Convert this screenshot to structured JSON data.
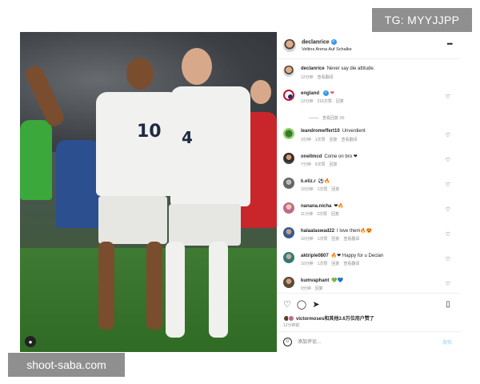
{
  "watermarks": {
    "top_right": "TG: MYYJJPP",
    "bottom_left": "shoot-saba.com"
  },
  "header": {
    "username": "declanrice",
    "location": "Veltins Arena Auf Schalke",
    "more_icon": "more-horizontal-icon"
  },
  "photo": {
    "player_left_number": "10",
    "player_right_number": "4",
    "user_tag_icon": "user-tag-icon"
  },
  "comments": [
    {
      "username": "declanrice",
      "text": "Never say die attitude.",
      "time": "12分钟",
      "likes": "",
      "reply": "",
      "translate": "查看翻译",
      "avatar": "av-declan"
    },
    {
      "username": "england",
      "text": "❤",
      "time": "12分钟",
      "likes": "216次赞",
      "reply": "回复",
      "translate": "",
      "avatar": "av-england"
    },
    {
      "username": "leandromeffert10",
      "text": "Unverdient",
      "time": "3分钟",
      "likes": "1次赞",
      "reply": "回复",
      "translate": "查看翻译",
      "avatar": "av-green"
    },
    {
      "username": "onellmcd",
      "text": "Come on bro ❤",
      "time": "7分钟",
      "likes": "6次赞",
      "reply": "回复",
      "translate": "",
      "avatar": "av-dark"
    },
    {
      "username": "k.eliz.r",
      "text": "⚽🔥",
      "time": "10分钟",
      "likes": "1次赞",
      "reply": "回复",
      "translate": "",
      "avatar": "av-grey"
    },
    {
      "username": "nanana.nicha",
      "text": "❤🔥",
      "time": "11分钟",
      "likes": "2次赞",
      "reply": "回复",
      "translate": "",
      "avatar": "av-pink"
    },
    {
      "username": "halaalaswad22",
      "text": "I love them🔥😍",
      "time": "10分钟",
      "likes": "1次赞",
      "reply": "回复",
      "translate": "查看翻译",
      "avatar": "av-blue"
    },
    {
      "username": "aktriple0807",
      "text": "🔥❤ Happy for u Declan",
      "time": "10分钟",
      "likes": "1次赞",
      "reply": "回复",
      "translate": "查看翻译",
      "avatar": "av-teal"
    },
    {
      "username": "kumvaphant",
      "text": "💚💙",
      "time": "9分钟",
      "likes": "",
      "reply": "回复",
      "translate": "",
      "avatar": "av-brown"
    }
  ],
  "view_replies": "查看回复 (4)",
  "actions": {
    "like_icon": "heart-icon",
    "comment_icon": "comment-icon",
    "share_icon": "send-icon",
    "save_icon": "bookmark-icon",
    "likes_text": "victormoses和其他3.6万位用户赞了",
    "time_ago": "12分钟前"
  },
  "add_comment": {
    "placeholder": "添加评论...",
    "post_label": "发布"
  }
}
